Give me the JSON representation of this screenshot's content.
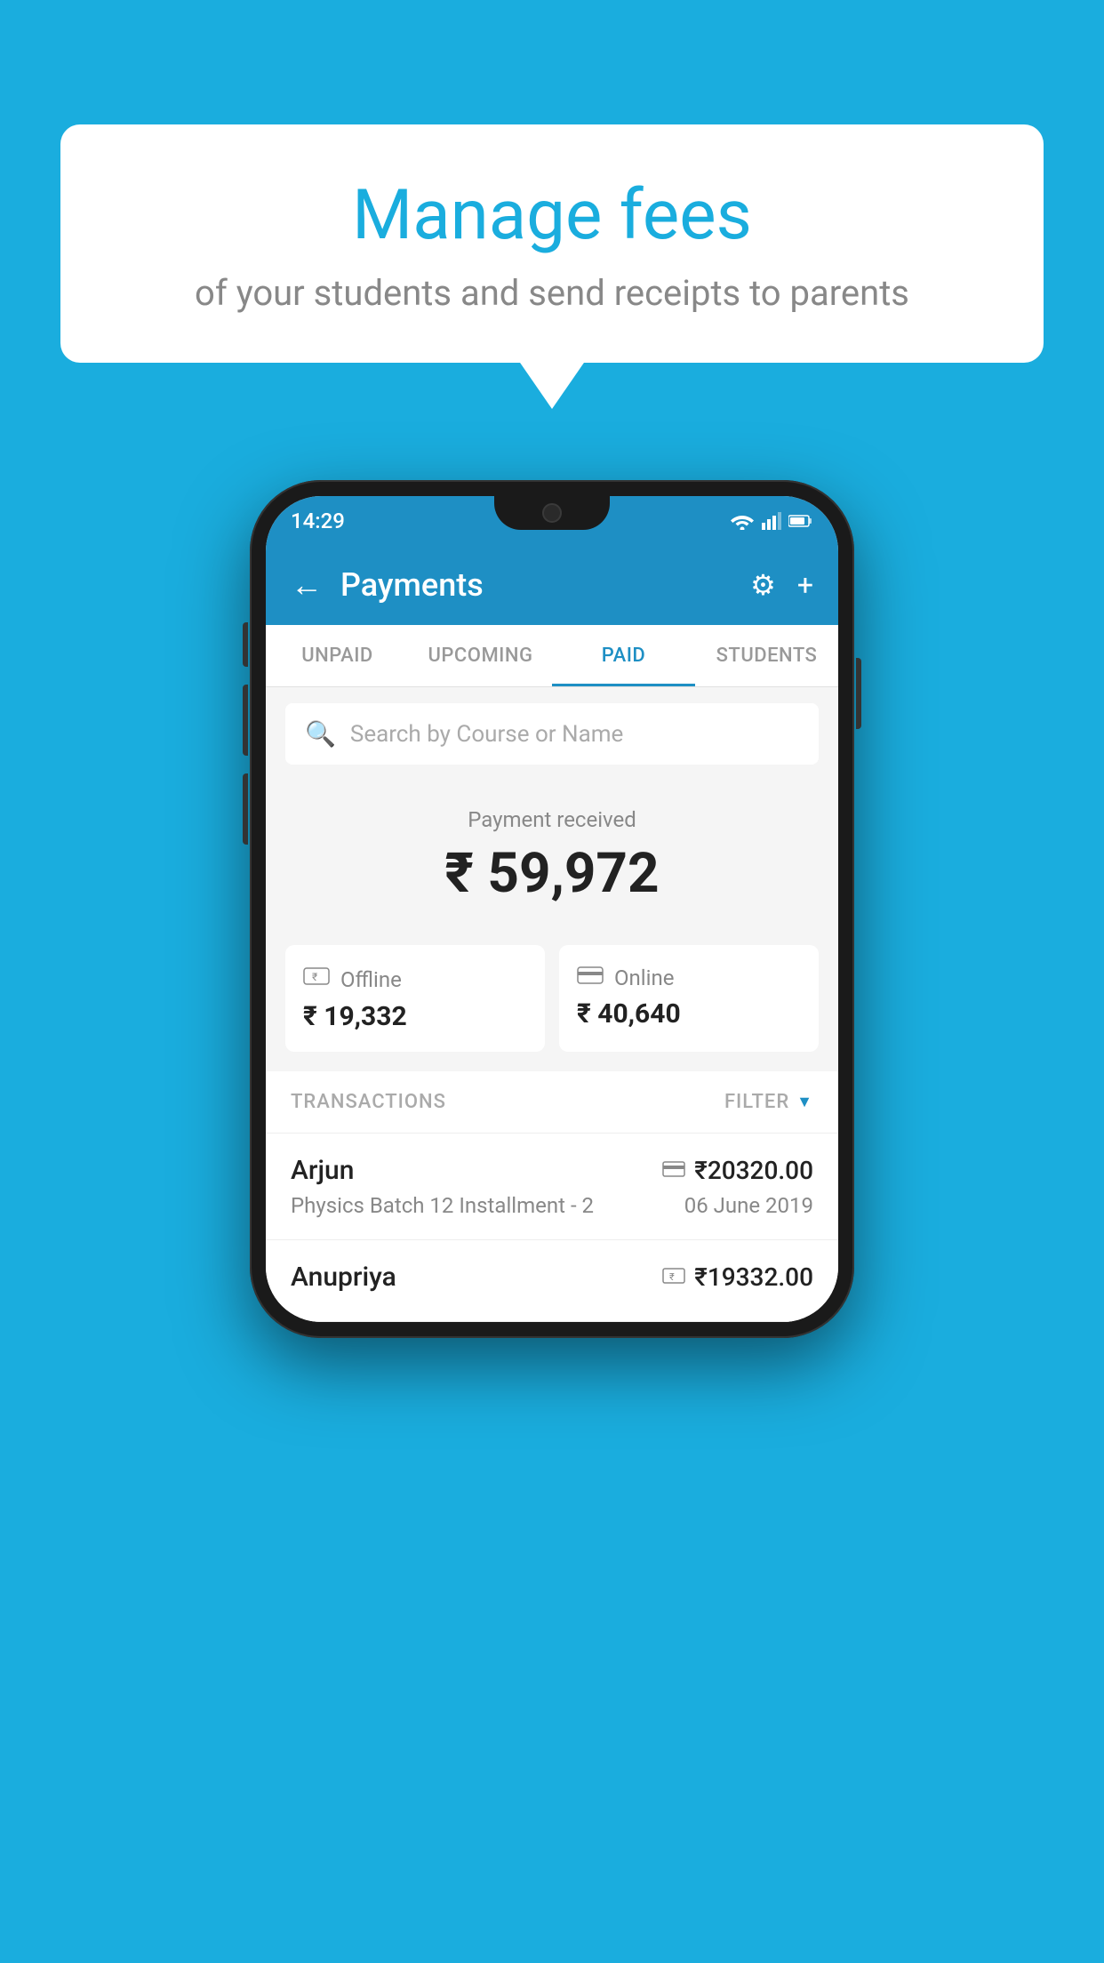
{
  "background_color": "#1AADDE",
  "bubble": {
    "title": "Manage fees",
    "subtitle": "of your students and send receipts to parents"
  },
  "phone": {
    "status_bar": {
      "time": "14:29"
    },
    "app_bar": {
      "title": "Payments",
      "back_icon": "←",
      "settings_icon": "⚙",
      "add_icon": "+"
    },
    "tabs": [
      {
        "label": "UNPAID",
        "active": false
      },
      {
        "label": "UPCOMING",
        "active": false
      },
      {
        "label": "PAID",
        "active": true
      },
      {
        "label": "STUDENTS",
        "active": false
      }
    ],
    "search": {
      "placeholder": "Search by Course or Name"
    },
    "payment": {
      "label": "Payment received",
      "amount": "₹ 59,972",
      "offline": {
        "label": "Offline",
        "amount": "₹ 19,332"
      },
      "online": {
        "label": "Online",
        "amount": "₹ 40,640"
      }
    },
    "transactions": {
      "section_label": "TRANSACTIONS",
      "filter_label": "FILTER",
      "items": [
        {
          "name": "Arjun",
          "amount": "₹20320.00",
          "course": "Physics Batch 12 Installment - 2",
          "date": "06 June 2019",
          "payment_type": "card"
        },
        {
          "name": "Anupriya",
          "amount": "₹19332.00",
          "course": "",
          "date": "",
          "payment_type": "cash"
        }
      ]
    }
  }
}
